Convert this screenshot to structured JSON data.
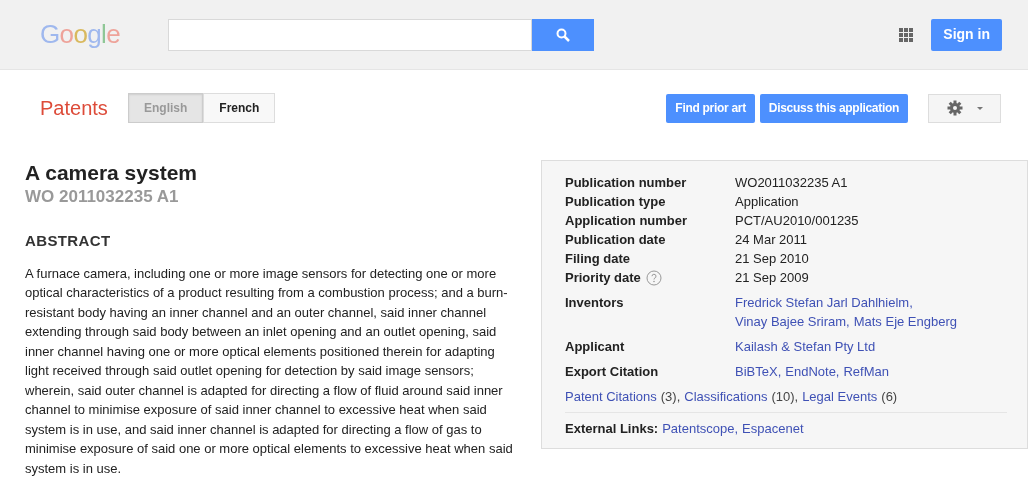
{
  "header": {
    "logo": "Google",
    "sign_in": "Sign in"
  },
  "subheader": {
    "title": "Patents",
    "languages": [
      {
        "label": "English",
        "selected": true
      },
      {
        "label": "French",
        "selected": false
      }
    ],
    "buttons": [
      "Find prior art",
      "Discuss this application"
    ]
  },
  "patent": {
    "title": "A camera system",
    "number": "WO 2011032235 A1",
    "abstract_heading": "ABSTRACT",
    "abstract": "A furnace camera, including one or more image sensors for detecting one or more optical characteristics of a product resulting from a combustion process; and a burn-resistant body having an inner channel and an outer channel, said inner channel extending through said body between an inlet opening and an outlet opening, said inner channel having one or more optical elements positioned therein for adapting light received through said outlet opening for detection by said image sensors; wherein, said outer channel is adapted for directing a flow of fluid around said inner channel to minimise exposure of said inner channel to excessive heat when said system is in use, and said inner channel is adapted for directing a flow of gas to minimise exposure of said one or more optical elements to excessive heat when said system is in use."
  },
  "details": {
    "fields": [
      {
        "kind": "text",
        "label": "Publication number",
        "value": "WO2011032235 A1"
      },
      {
        "kind": "text",
        "label": "Publication type",
        "value": "Application"
      },
      {
        "kind": "text",
        "label": "Application number",
        "value": "PCT/AU2010/001235"
      },
      {
        "kind": "text",
        "label": "Publication date",
        "value": "24 Mar 2011"
      },
      {
        "kind": "text",
        "label": "Filing date",
        "value": "21 Sep 2010"
      },
      {
        "kind": "text",
        "label": "Priority date",
        "value": "21 Sep 2009",
        "help": true
      },
      {
        "kind": "links",
        "label": "Inventors",
        "links": [
          "Fredrick Stefan Jarl Dahlhielm",
          "Vinay Bajee Sriram",
          "Mats Eje Engberg"
        ]
      },
      {
        "kind": "links",
        "label": "Applicant",
        "links": [
          "Kailash & Stefan Pty Ltd"
        ]
      },
      {
        "kind": "links",
        "label": "Export Citation",
        "links": [
          "BiBTeX",
          "EndNote",
          "RefMan"
        ]
      }
    ],
    "separator": ",",
    "counts": [
      {
        "label": "Patent Citations",
        "count": "(3)"
      },
      {
        "label": "Classifications",
        "count": "(10)"
      },
      {
        "label": "Legal Events",
        "count": "(6)"
      }
    ],
    "external": {
      "label": "External Links:",
      "links": [
        "Patentscope",
        "Espacenet"
      ]
    }
  }
}
